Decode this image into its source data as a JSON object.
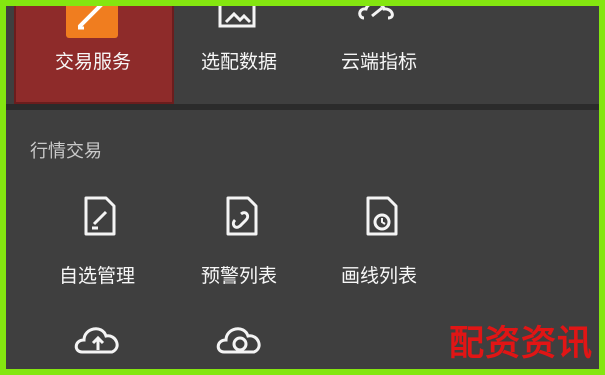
{
  "top_row": {
    "items": [
      {
        "label": "交易服务",
        "icon": "edit-square-icon",
        "selected": true
      },
      {
        "label": "选配数据",
        "icon": "image-frame-icon",
        "selected": false
      },
      {
        "label": "云端指标",
        "icon": "cloud-link-icon",
        "selected": false
      }
    ]
  },
  "section": {
    "title": "行情交易",
    "items": [
      {
        "label": "自选管理",
        "icon": "document-edit-icon"
      },
      {
        "label": "预警列表",
        "icon": "document-link-icon"
      },
      {
        "label": "画线列表",
        "icon": "document-refresh-icon"
      },
      {
        "label": "",
        "icon": "cloud-upload-icon"
      },
      {
        "label": "",
        "icon": "cloud-sync-icon"
      }
    ]
  },
  "watermark": "配资资讯",
  "colors": {
    "border": "#84e610",
    "background": "#3f3f3f",
    "selected_tile": "#8e2b2a",
    "accent_orange": "#f07d1f",
    "watermark": "#e11515"
  }
}
